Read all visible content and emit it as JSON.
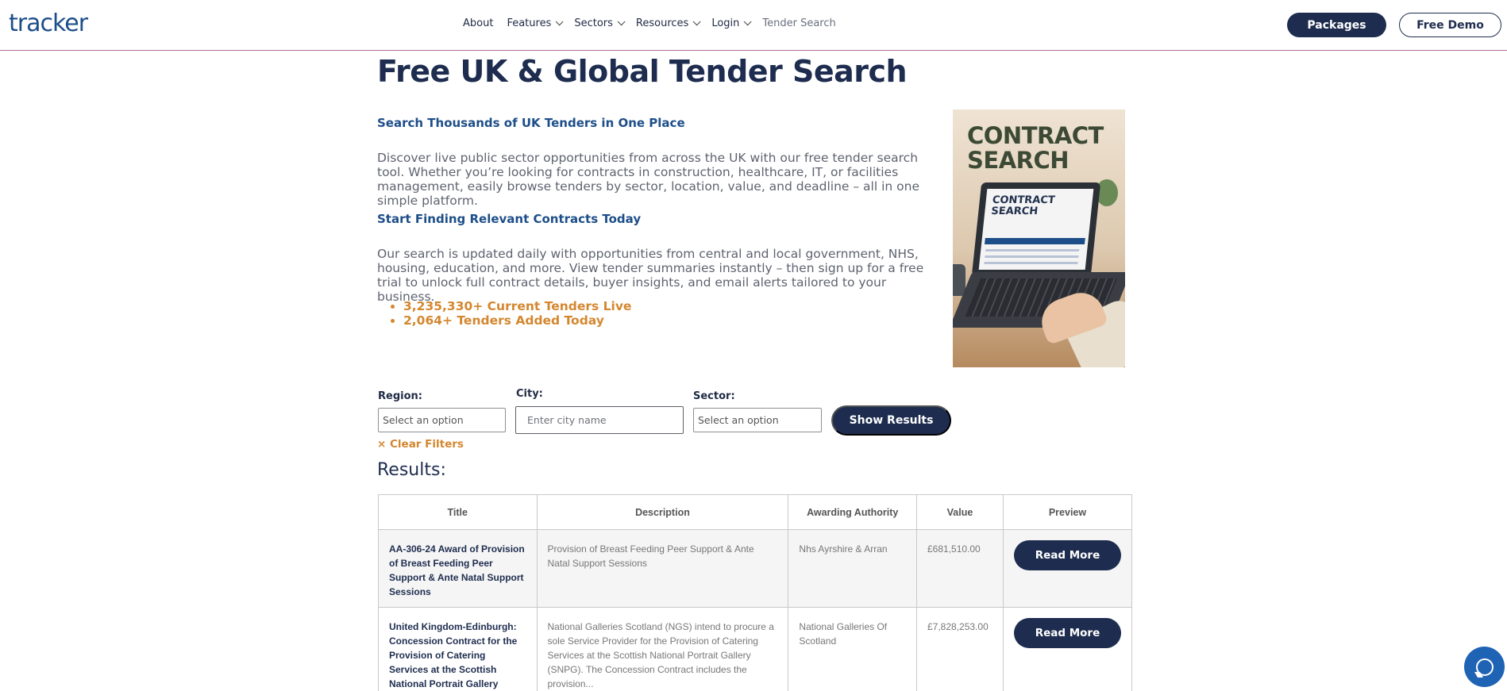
{
  "brand": {
    "logo_text": "tracker"
  },
  "nav": {
    "items": [
      {
        "label": "About",
        "dropdown": false
      },
      {
        "label": "Features",
        "dropdown": true
      },
      {
        "label": "Sectors",
        "dropdown": true
      },
      {
        "label": "Resources",
        "dropdown": true
      },
      {
        "label": "Login",
        "dropdown": true
      },
      {
        "label": "Tender Search",
        "dropdown": false
      }
    ],
    "packages_label": "Packages",
    "demo_label": "Free Demo"
  },
  "hero": {
    "title": "Free UK & Global Tender Search",
    "subtitle1": "Search Thousands of UK Tenders in One Place",
    "para1": "Discover live public sector opportunities from across the UK with our free tender search tool. Whether you’re looking for contracts in construction, healthcare, IT, or facilities management, easily browse tenders by sector, location, value, and deadline – all in one simple platform.",
    "subtitle2": "Start Finding Relevant Contracts Today",
    "para2": "Our search is updated daily with opportunities from central and local government, NHS, housing, education, and more. View tender summaries instantly – then sign up for a free trial to unlock full contract details, buyer insights, and email alerts tailored to your business.",
    "stats": [
      "3,235,330+ Current Tenders Live",
      "2,064+ Tenders Added Today"
    ]
  },
  "promo": {
    "title_line1": "CONTRACT",
    "title_line2": "SEARCH",
    "screen_line1": "CONTRACT",
    "screen_line2": "SEARCH"
  },
  "filters": {
    "region_label": "Region:",
    "region_placeholder": "Select an option",
    "city_label": "City:",
    "city_placeholder": "Enter city name",
    "sector_label": "Sector:",
    "sector_placeholder": "Select an option",
    "show_label": "Show Results",
    "clear_label": "× Clear Filters"
  },
  "results": {
    "heading": "Results:",
    "columns": [
      "Title",
      "Description",
      "Awarding Authority",
      "Value",
      "Preview"
    ],
    "rows": [
      {
        "title": "AA-306-24 Award of Provision of Breast Feeding Peer Support & Ante Natal Support Sessions",
        "description": "Provision of Breast Feeding Peer Support & Ante Natal Support Sessions",
        "authority": "Nhs Ayrshire & Arran",
        "value": "£681,510.00",
        "action": "Read More"
      },
      {
        "title": "United Kingdom-Edinburgh: Concession Contract for the Provision of Catering Services at the Scottish National Portrait Gallery",
        "description": "National Galleries Scotland (NGS) intend to procure a sole Service Provider for the Provision of Catering Services at the Scottish National Portrait Gallery (SNPG). The Concession Contract includes the provision...",
        "authority": "National Galleries Of Scotland",
        "value": "£7,828,253.00",
        "action": "Read More"
      }
    ]
  },
  "colors": {
    "navy": "#1e2d4f",
    "accent": "#d4872f",
    "link_blue": "#1d4e89",
    "chat_blue": "#1f63b4"
  }
}
